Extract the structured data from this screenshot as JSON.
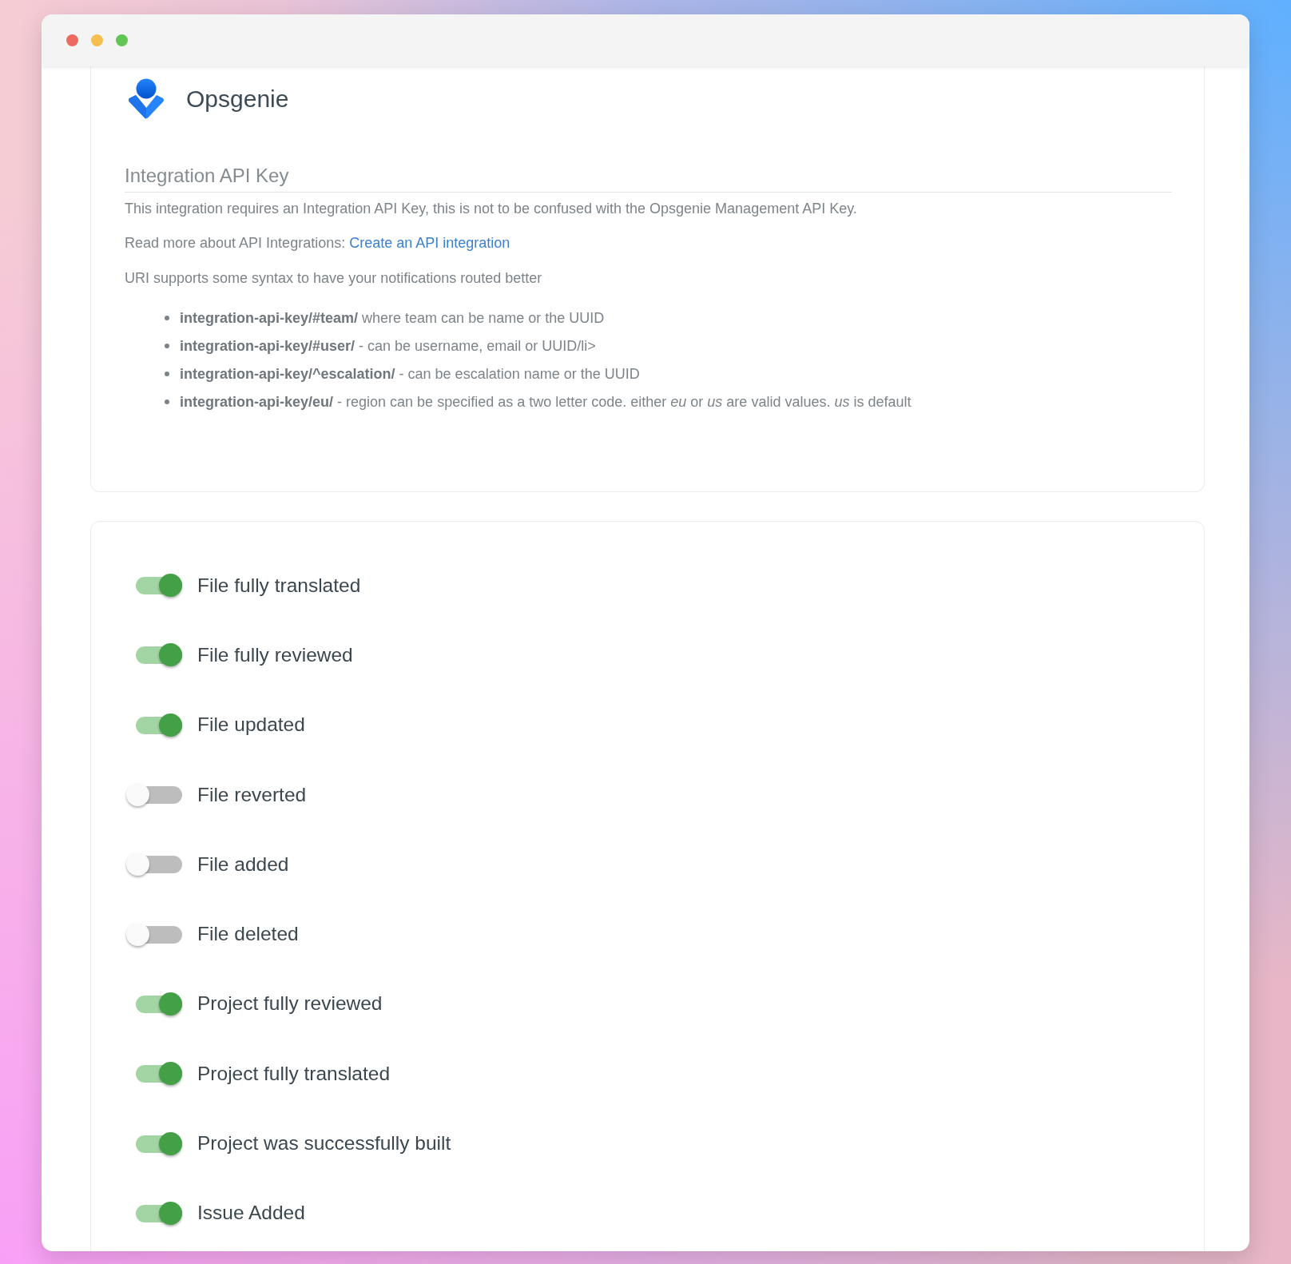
{
  "integration": {
    "name": "Opsgenie"
  },
  "api_key_section": {
    "heading": "Integration API Key",
    "description": "This integration requires an Integration API Key, this is not to be confused with the Opsgenie Management API Key.",
    "read_more": {
      "text": "Read more about API Integrations:",
      "link": "Create an API integration"
    },
    "syntax_intro": "URI supports some syntax to have your notifications routed better",
    "syntax_items": [
      "**integration-api-key/#team/** where team can be name or the UUID",
      "**integration-api-key/#user/** - can be username, email or UUID/li>",
      "**integration-api-key/^escalation/** - can be escalation name or the UUID",
      "**integration-api-key/eu/** - region can be specified as a two letter code. either *eu* or *us* are valid values. *us* is default"
    ]
  },
  "notifications": [
    {
      "label": "File fully translated",
      "on": true
    },
    {
      "label": "File fully reviewed",
      "on": true
    },
    {
      "label": "File updated",
      "on": true
    },
    {
      "label": "File reverted",
      "on": false
    },
    {
      "label": "File added",
      "on": false
    },
    {
      "label": "File deleted",
      "on": false
    },
    {
      "label": "Project fully reviewed",
      "on": true
    },
    {
      "label": "Project fully translated",
      "on": true
    },
    {
      "label": "Project was successfully built",
      "on": true
    },
    {
      "label": "Issue Added",
      "on": true
    }
  ]
}
